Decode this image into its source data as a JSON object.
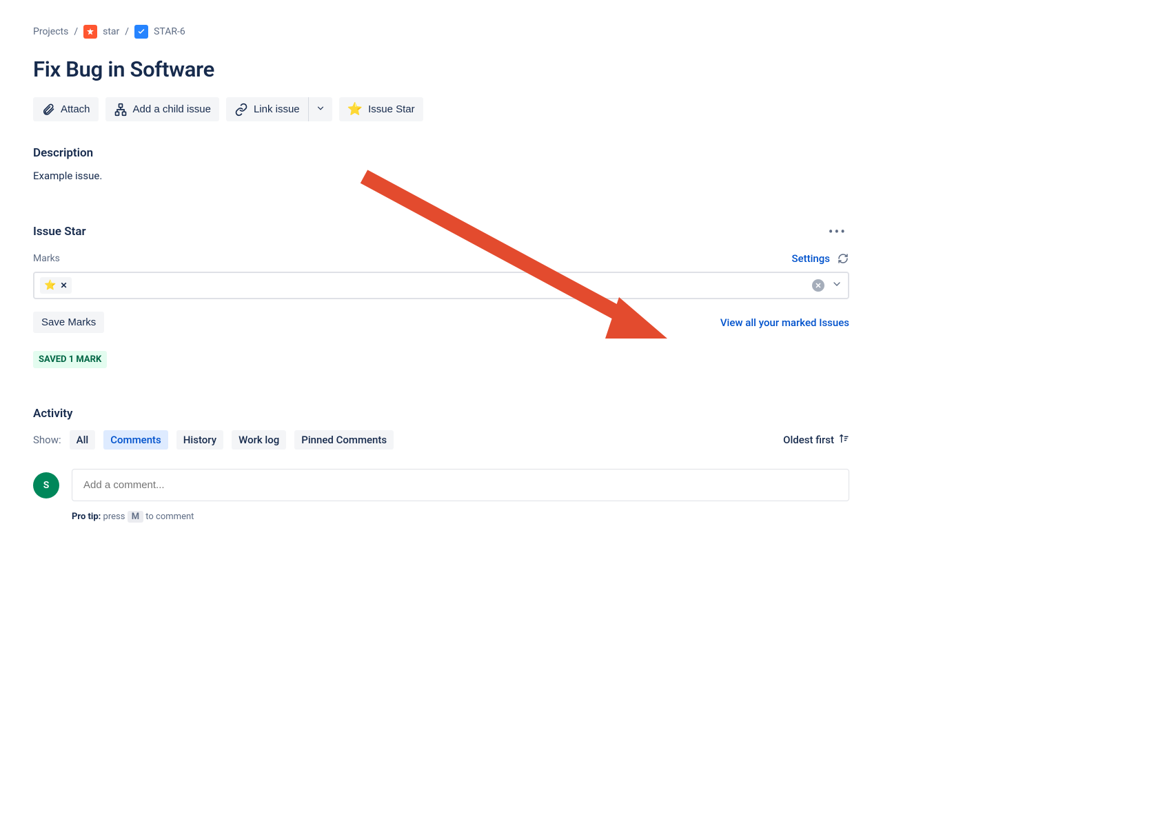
{
  "breadcrumb": {
    "root": "Projects",
    "project": "star",
    "issue": "STAR-6"
  },
  "title": "Fix Bug in Software",
  "actions": {
    "attach": "Attach",
    "add_child": "Add a child issue",
    "link_issue": "Link issue",
    "issue_star": "Issue Star"
  },
  "description": {
    "heading": "Description",
    "body": "Example issue."
  },
  "issue_star_panel": {
    "heading": "Issue Star",
    "marks_label": "Marks",
    "settings": "Settings",
    "chip_icon": "⭐",
    "save_button": "Save Marks",
    "view_all": "View all your marked Issues",
    "saved_badge": "SAVED 1 MARK"
  },
  "activity": {
    "heading": "Activity",
    "show_label": "Show:",
    "tabs": {
      "all": "All",
      "comments": "Comments",
      "history": "History",
      "worklog": "Work log",
      "pinned": "Pinned Comments"
    },
    "sort": "Oldest first"
  },
  "comment": {
    "avatar": "S",
    "placeholder": "Add a comment...",
    "tip_prefix": "Pro tip:",
    "tip_text_a": " press ",
    "tip_key": "M",
    "tip_text_b": " to comment"
  }
}
